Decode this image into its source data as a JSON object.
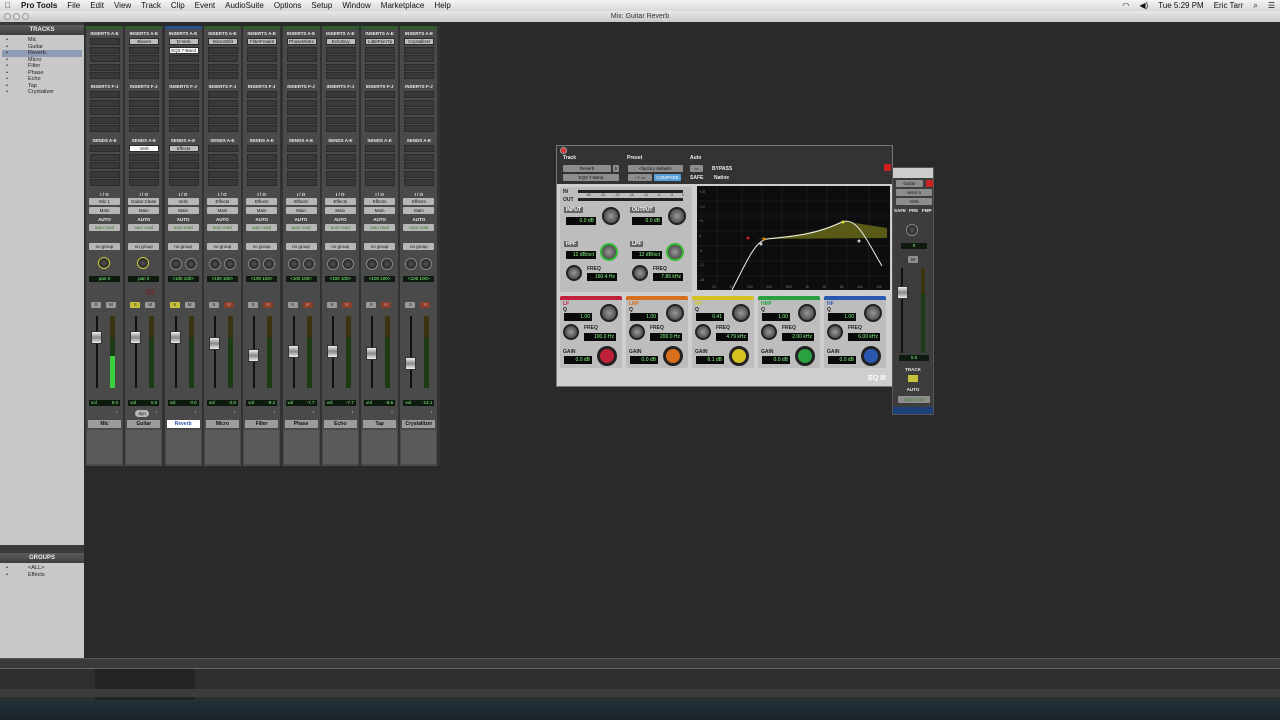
{
  "menubar": {
    "app": "Pro Tools",
    "items": [
      "File",
      "Edit",
      "View",
      "Track",
      "Clip",
      "Event",
      "AudioSuite",
      "Options",
      "Setup",
      "Window",
      "Marketplace",
      "Help"
    ],
    "clock": "Tue 5:29 PM",
    "user": "Eric Tarr"
  },
  "window": {
    "title": "Mix: Guitar Reverb"
  },
  "tracks_panel": {
    "title": "TRACKS",
    "items": [
      "Mic",
      "Guitar",
      "Reverb",
      "Micro",
      "Filter",
      "Phase",
      "Echo",
      "Tap",
      "Crystalizer"
    ],
    "selected": 2
  },
  "groups_panel": {
    "title": "GROUPS",
    "items": [
      "<ALL>",
      "Effects"
    ]
  },
  "mixer": {
    "labels": {
      "inserts_ae": "INSERTS A-E",
      "inserts_fj": "INSERTS F-J",
      "sends_ae": "SENDS A-E",
      "io": "I / O",
      "auto": "AUTO",
      "group": "no group",
      "solo": "S",
      "mute": "M"
    },
    "strips": [
      {
        "name": "Mic",
        "insert": "",
        "insert2": "",
        "send": "",
        "input": "Mic 1",
        "output": "Main",
        "auto": "auto read",
        "pan": "pan  0",
        "stereo": false,
        "vol": "0.0",
        "fader": 0.78,
        "meter": 0.45,
        "solo": false,
        "mute_on": false
      },
      {
        "name": "Guitar",
        "insert": "Eleven",
        "insert2": "",
        "send": "Verb",
        "input": "Guitar Clean",
        "output": "Main",
        "auto": "auto read",
        "pan": "pan  0",
        "stereo": false,
        "vol": "0.0",
        "fader": 0.78,
        "meter": 0,
        "solo": true,
        "mute_on": false,
        "dyn": "dyn"
      },
      {
        "name": "Reverb",
        "insert": "D-Verb",
        "insert2": "EQ3 7-Band",
        "send": "Effects",
        "input": "Verb",
        "output": "Main",
        "auto": "auto read",
        "pan": "<100  100>",
        "stereo": true,
        "vol": "0.0",
        "fader": 0.78,
        "meter": 0,
        "solo": true,
        "mute_on": false
      },
      {
        "name": "Micro",
        "insert": "MicroShift",
        "insert2": "",
        "send": "",
        "input": "Effects",
        "output": "Main",
        "auto": "auto read",
        "pan": "<100  100>",
        "stereo": true,
        "vol": "-2.8",
        "fader": 0.68,
        "meter": 0,
        "solo": false,
        "mute_on": true
      },
      {
        "name": "Filter",
        "insert": "FilterFreak2",
        "insert2": "",
        "send": "",
        "input": "Effects",
        "output": "Main",
        "auto": "auto read",
        "pan": "<100  100>",
        "stereo": true,
        "vol": "-9.2",
        "fader": 0.5,
        "meter": 0,
        "solo": false,
        "mute_on": true
      },
      {
        "name": "Phase",
        "insert": "PhaseMistrs",
        "insert2": "",
        "send": "",
        "input": "Effects",
        "output": "Main",
        "auto": "auto read",
        "pan": "<100  100>",
        "stereo": true,
        "vol": "-7.7",
        "fader": 0.56,
        "meter": 0,
        "solo": false,
        "mute_on": true
      },
      {
        "name": "Echo",
        "insert": "EchoBoy",
        "insert2": "",
        "send": "",
        "input": "Effects",
        "output": "Main",
        "auto": "auto read",
        "pan": "<100  100>",
        "stereo": true,
        "vol": "-7.7",
        "fader": 0.56,
        "meter": 0,
        "solo": false,
        "mute_on": true
      },
      {
        "name": "Tap",
        "insert": "LittlePrimTp",
        "insert2": "",
        "send": "",
        "input": "Effects",
        "output": "Main",
        "auto": "auto read",
        "pan": "<100  100>",
        "stereo": true,
        "vol": "-8.6",
        "fader": 0.53,
        "meter": 0,
        "solo": false,
        "mute_on": true
      },
      {
        "name": "Crystallizer",
        "insert": "Crystallizer",
        "insert2": "",
        "send": "",
        "input": "Effects",
        "output": "Main",
        "auto": "auto read",
        "pan": "<100  100>",
        "stereo": true,
        "vol": "-14.1",
        "fader": 0.38,
        "meter": 0,
        "solo": false,
        "mute_on": true
      }
    ]
  },
  "plugin": {
    "track_label": "Track",
    "preset_label": "Preset",
    "auto_label": "Auto",
    "track": "Reverb",
    "track_suffix": "b",
    "insert": "EQ3 7-Band",
    "preset": "<factory default>",
    "compare": "COMPARE",
    "bypass": "BYPASS",
    "safe": "SAFE",
    "native": "Native",
    "in": "IN",
    "out": "OUT",
    "meter_scale": [
      "-60",
      "-32",
      "-22",
      "-16",
      "-10",
      "-6",
      "-3",
      "0"
    ],
    "input": {
      "label": "INPUT",
      "value": "0.0 dB"
    },
    "output": {
      "label": "OUTPUT",
      "value": "0.0 dB"
    },
    "hpf": {
      "label": "HPF",
      "q": "12 dB/oct",
      "freq": "160.4 Hz"
    },
    "lpf": {
      "label": "LPF",
      "q": "12 dB/oct",
      "freq": "7.86 kHz"
    },
    "graph_x": [
      "20",
      "50",
      "100",
      "200",
      "500",
      "1k",
      "2k",
      "5k",
      "10k",
      "20k"
    ],
    "graph_y": [
      "+18",
      "+12",
      "+6",
      "0",
      "-6",
      "-12",
      "-18"
    ],
    "q_label": "Q",
    "freq_label": "FREQ",
    "gain_label": "GAIN",
    "bands": [
      {
        "label": "LF",
        "q": "1.00",
        "freq": "100.0 Hz",
        "gain": "0.0 dB",
        "color": "#c0203a"
      },
      {
        "label": "LMF",
        "q": "1.00",
        "freq": "200.0 Hz",
        "gain": "0.0 dB",
        "color": "#d9701e"
      },
      {
        "label": "MF",
        "q": "0.41",
        "freq": "4.79 kHz",
        "gain": "6.1 dB",
        "color": "#d6c21e"
      },
      {
        "label": "HMF",
        "q": "1.00",
        "freq": "2.00 kHz",
        "gain": "0.0 dB",
        "color": "#2aa040"
      },
      {
        "label": "HF",
        "q": "1.00",
        "freq": "6.00 kHz",
        "gain": "0.0 dB",
        "color": "#2a58b0"
      }
    ],
    "logo": "EQ III"
  },
  "send_window": {
    "track": "Guitar",
    "send": "send a",
    "dest": "Verb",
    "safe": "SAFE",
    "pre": "PRE",
    "fmp": "FMP",
    "pan": "0",
    "mute": "M",
    "level": "0.0",
    "track_label": "TRACK",
    "auto_label": "AUTO",
    "auto": "auto read"
  }
}
